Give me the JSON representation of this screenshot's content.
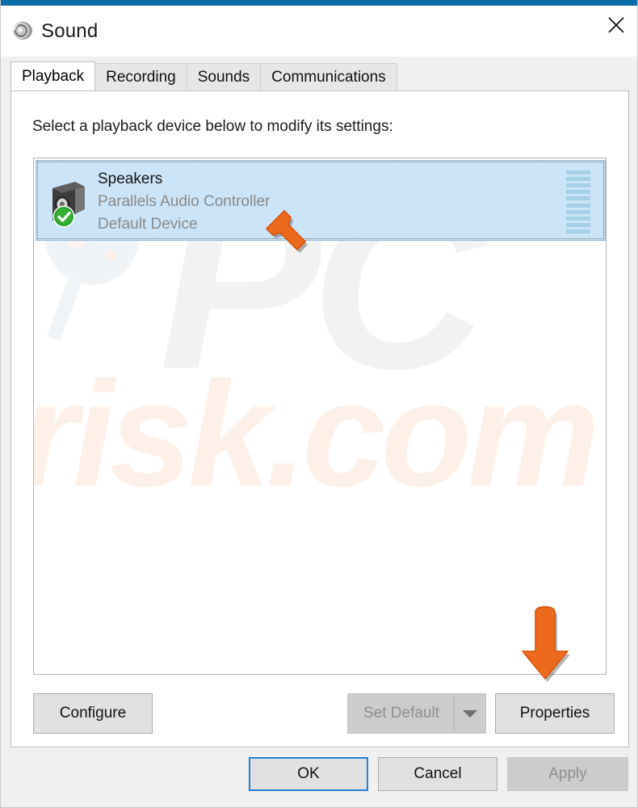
{
  "window": {
    "title": "Sound",
    "accent_color": "#0c6ca7",
    "title_icon": "speaker-icon",
    "close_label": "✕"
  },
  "tabs": [
    {
      "label": "Playback",
      "active": true
    },
    {
      "label": "Recording",
      "active": false
    },
    {
      "label": "Sounds",
      "active": false
    },
    {
      "label": "Communications",
      "active": false
    }
  ],
  "playback": {
    "instruction": "Select a playback device below to modify its settings:",
    "devices": [
      {
        "name": "Speakers",
        "description": "Parallels Audio Controller",
        "status": "Default Device",
        "icon": "speaker-device-icon",
        "badge": "green-check-icon",
        "selected": true,
        "meter_segments": 10,
        "meter_color": "#a6d0e8"
      }
    ]
  },
  "actions": {
    "configure_label": "Configure",
    "set_default_label": "Set Default",
    "set_default_disabled": true,
    "set_default_dropdown_icon": "chevron-down-icon",
    "properties_label": "Properties"
  },
  "footer": {
    "ok_label": "OK",
    "cancel_label": "Cancel",
    "apply_label": "Apply",
    "apply_disabled": true
  },
  "watermark": {
    "primary": "PC",
    "secondary": "risk.com",
    "primary_color": "#f2f2f2",
    "secondary_color": "#fdf0e8"
  },
  "annotations": {
    "arrow_color": "#ed6a1c",
    "cursor_arrow": "arrow-cursor-annotation",
    "down_arrow": "arrow-down-annotation"
  }
}
